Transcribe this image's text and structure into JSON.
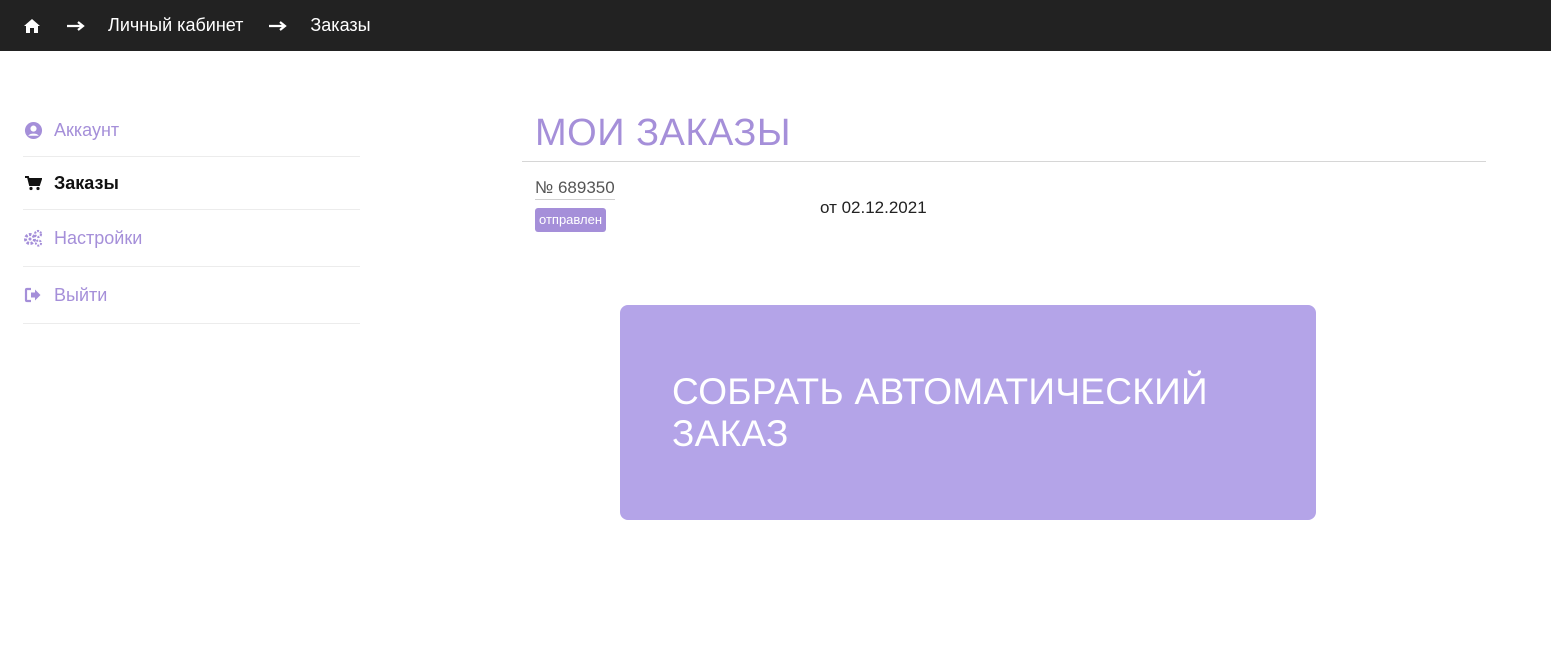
{
  "breadcrumb": {
    "home_icon": "home-icon",
    "items": [
      {
        "label": "Личный кабинет"
      },
      {
        "label": "Заказы"
      }
    ]
  },
  "sidebar": {
    "items": [
      {
        "label": "Аккаунт",
        "icon": "user-circle-icon"
      },
      {
        "label": "Заказы",
        "icon": "cart-icon",
        "active": true
      },
      {
        "label": "Настройки",
        "icon": "gears-icon"
      },
      {
        "label": "Выйти",
        "icon": "sign-out-icon"
      }
    ]
  },
  "main": {
    "title": "МОИ ЗАКАЗЫ",
    "orders": [
      {
        "number": "№ 689350",
        "status": "отправлен",
        "date": "от 02.12.2021"
      }
    ],
    "auto_order_button": "СОБРАТЬ АВТОМАТИЧЕСКИЙ ЗАКАЗ"
  },
  "colors": {
    "accent": "#a58fd9",
    "button_bg": "#b4a4e8",
    "topbar_bg": "#222222"
  }
}
